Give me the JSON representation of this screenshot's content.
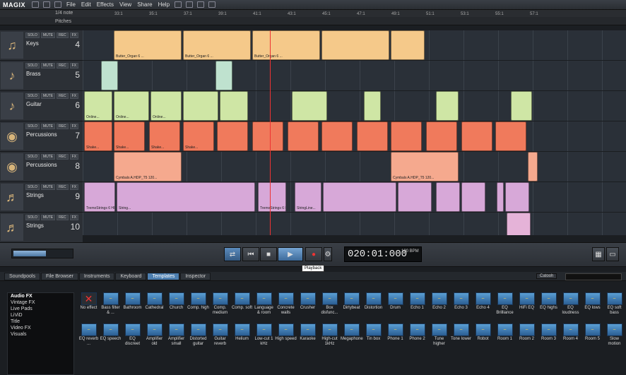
{
  "app": {
    "logo": "MAGIX"
  },
  "menu": [
    "File",
    "Edit",
    "Effects",
    "View",
    "Share",
    "Help"
  ],
  "header": {
    "snap": "1/4 note",
    "pitches": "Pitches"
  },
  "ruler": [
    "33:1",
    "35:1",
    "37:1",
    "39:1",
    "41:1",
    "43:1",
    "45:1",
    "47:1",
    "49:1",
    "51:1",
    "53:1",
    "55:1",
    "57:1"
  ],
  "tracks": [
    {
      "name": "Keys",
      "num": "4",
      "icon": "keyboard-icon",
      "color": "#f5c98a"
    },
    {
      "name": "Brass",
      "num": "5",
      "icon": "trumpet-icon",
      "color": "#bfe2cf"
    },
    {
      "name": "Guitar",
      "num": "6",
      "icon": "guitar-icon",
      "color": "#cfe6a5"
    },
    {
      "name": "Percussions",
      "num": "7",
      "icon": "drum-icon",
      "color": "#f07a5c"
    },
    {
      "name": "Percussions",
      "num": "8",
      "icon": "drum-icon",
      "color": "#f5a98e"
    },
    {
      "name": "Strings",
      "num": "9",
      "icon": "violin-icon",
      "color": "#d7a8d8"
    },
    {
      "name": "Strings",
      "num": "10",
      "icon": "violin-icon",
      "color": "#e5b3d8"
    }
  ],
  "track_buttons": [
    "SOLO",
    "MUTE",
    "REC",
    "FX"
  ],
  "clips": {
    "keys": [
      "Butter_Organ 6 ...",
      "Butter_Organ 6 ...",
      "Butter_Organ 6 ..."
    ],
    "guitar": [
      "Online...",
      "Online...",
      "Online..."
    ],
    "perc7": [
      "Shake...",
      "Shake...",
      "Shake...",
      "Shake..."
    ],
    "perc8": [
      "Cymbals A.HDP_T5 120...",
      "Cymbals A.HDP_T5 120..."
    ],
    "strings": [
      "TremoStrings 6 HDP_T5 120.00 BPM",
      "String...",
      "TremoStrings 6 HDP_T5 120...",
      "StringLine..."
    ]
  },
  "transport": {
    "time": "020:01:000",
    "bpm": "100 BPM",
    "tooltip": "Playback"
  },
  "tabs": [
    "Soundpools",
    "File Browser",
    "Instruments",
    "Keyboard",
    "Templates",
    "Inspector"
  ],
  "active_tab": "Templates",
  "catooh": "Catooh",
  "categories": [
    "Audio FX",
    "Vintage FX",
    "Live Pads",
    "LiViD",
    "Title",
    "Video FX",
    "Visuals"
  ],
  "effects_row1": [
    "No effect",
    "Bass filter & ...",
    "Bathroom",
    "Cathedral",
    "Church",
    "Comp. high",
    "Comp. medium",
    "Comp. soft",
    "Language & room",
    "Concrete walls",
    "Crusher",
    "Box disfunc...",
    "Dirtybeat",
    "Distortion",
    "Drum",
    "Echo 1",
    "Echo 2",
    "Echo 3",
    "Echo 4",
    "EQ Brilliance",
    "HiFi EQ",
    "EQ highs",
    "EQ loudness",
    "EQ lows",
    "EQ soft bass"
  ],
  "effects_row2": [
    "EQ reverb ...",
    "EQ speech",
    "EQ discreet",
    "Amplifier old",
    "Amplifier small",
    "Distorted guitar",
    "Guitar reverb",
    "Helium",
    "Low-cut 1 kHz",
    "High speed",
    "Karaoke",
    "High-cut 1kHz",
    "Megaphone",
    "Tin box",
    "Phone 1",
    "Phone 2",
    "Tune higher",
    "Tone lower",
    "Robot",
    "Room 1",
    "Room 2",
    "Room 3",
    "Room 4",
    "Room 5",
    "Slow motion"
  ],
  "zoom_label": "Zoom",
  "zoom_level": 0.55
}
